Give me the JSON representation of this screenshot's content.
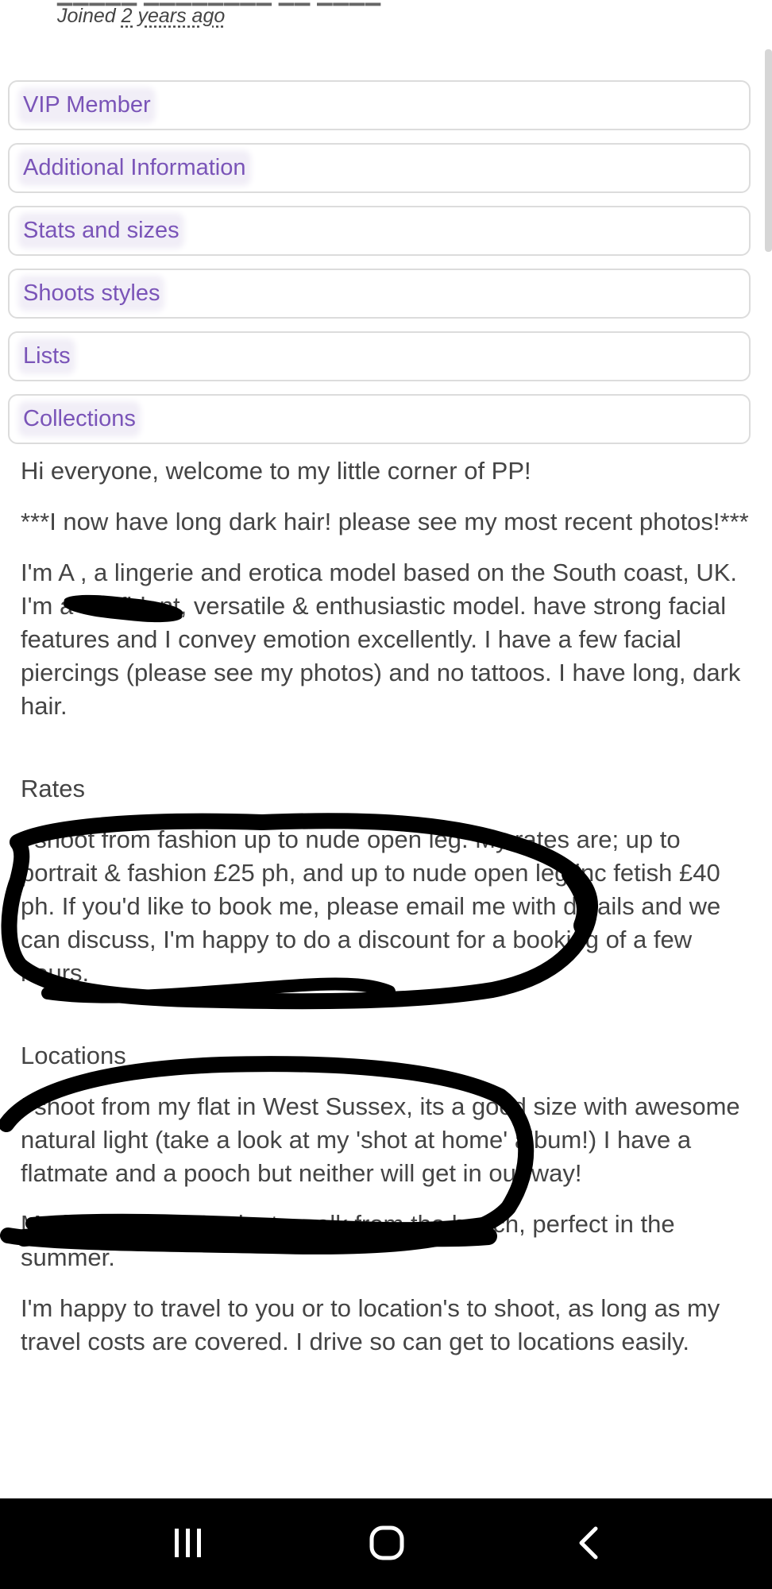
{
  "profile": {
    "joined_prefix": "Joined",
    "joined_ago": "2 years ago"
  },
  "accordion": {
    "items": [
      {
        "label": "VIP Member"
      },
      {
        "label": "Additional Information"
      },
      {
        "label": "Stats and sizes"
      },
      {
        "label": "Shoots styles"
      },
      {
        "label": "Lists"
      },
      {
        "label": "Collections"
      }
    ]
  },
  "bio": {
    "p1": "Hi everyone, welcome to my little corner of PP!",
    "p2": "***I now have long dark hair! please see my most recent photos!***",
    "p3": "I'm A          , a lingerie and erotica model based on the South coast, UK.  I'm a confident, versatile & enthusiastic model. have strong facial features and I convey emotion excellently. I have a few facial piercings (please see my photos) and no tattoos. I have long, dark hair.",
    "rates_heading": "Rates",
    "rates_text": "I shoot from fashion up to nude open leg. My rates are; up to portrait & fashion £25 ph, and up to nude open leg inc fetish £40 ph. If you'd like to book me, please email me with details and we can discuss, I'm happy to do a discount for a booking of a few hours.",
    "locations_heading": "Locations",
    "locations_text": "I shoot from my flat in West Sussex, its a good size with awesome natural light (take a look at my 'shot at home' album!) I have a flatmate and a pooch but neither will get in our way!",
    "beach_text": "My flat is also a 3 minute walk from the beach, perfect in the summer.",
    "travel_text": "I'm happy to travel to you or to location's to shoot, as long as my travel costs are covered. I drive so can get to locations easily."
  },
  "colors": {
    "accent": "#7a54b8",
    "text": "#444444",
    "border": "#dcdcdc",
    "navbar": "#000000"
  },
  "navbar": {
    "icons": [
      "recents-icon",
      "home-icon",
      "back-icon"
    ]
  }
}
